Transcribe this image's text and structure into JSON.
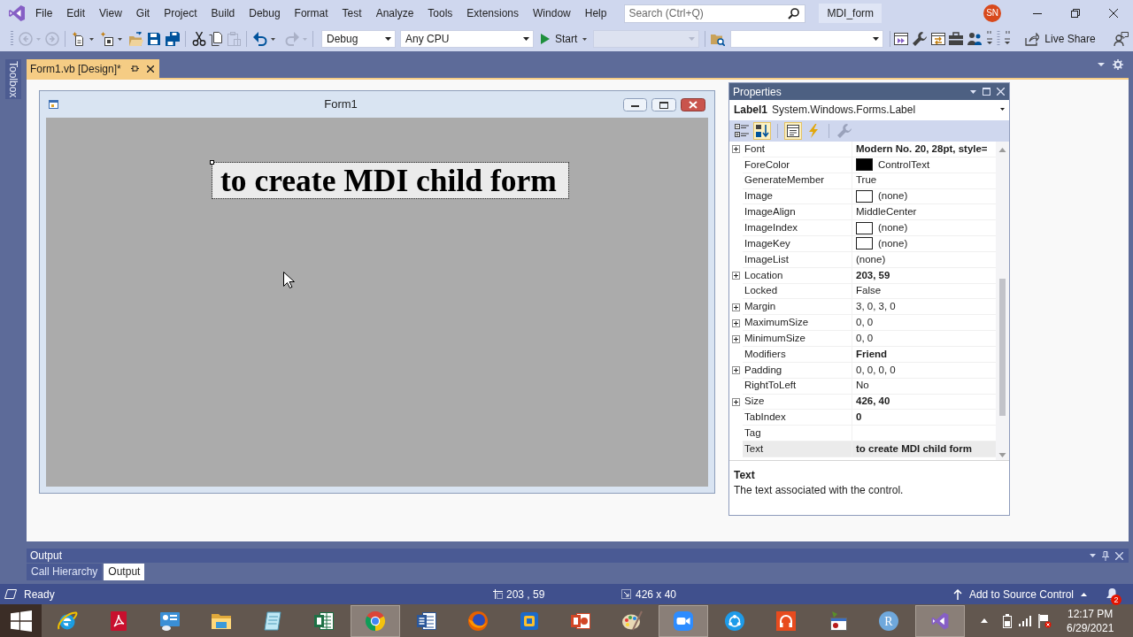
{
  "menu_bar": {
    "items": [
      "File",
      "Edit",
      "View",
      "Git",
      "Project",
      "Build",
      "Debug",
      "Format",
      "Test",
      "Analyze",
      "Tools",
      "Extensions",
      "Window",
      "Help"
    ],
    "search": {
      "placeholder": "Search (Ctrl+Q)"
    },
    "solution_name": "MDI_form",
    "user_initials": "SN"
  },
  "toolbar": {
    "button_groups": [
      [
        {
          "kind": "back",
          "disabled": true,
          "dropdown": true
        },
        {
          "kind": "forward",
          "disabled": true,
          "dropdown": false
        }
      ],
      [
        {
          "kind": "new_project",
          "disabled": false,
          "dropdown": true
        },
        {
          "kind": "add_item",
          "disabled": false,
          "dropdown": true
        },
        {
          "kind": "open",
          "disabled": false,
          "dropdown": false
        },
        {
          "kind": "save",
          "disabled": false,
          "dropdown": false
        },
        {
          "kind": "save_all",
          "disabled": false,
          "dropdown": false
        }
      ],
      [
        {
          "kind": "cut",
          "disabled": false,
          "dropdown": false
        },
        {
          "kind": "copy",
          "disabled": false,
          "dropdown": false
        },
        {
          "kind": "paste",
          "disabled": true,
          "dropdown": false
        }
      ],
      [
        {
          "kind": "undo",
          "disabled": false,
          "dropdown": true
        },
        {
          "kind": "redo",
          "disabled": true,
          "dropdown": true
        }
      ]
    ],
    "configuration": "Debug",
    "platform": "Any CPU",
    "start_label": "Start",
    "startup_item": {
      "disabled": true
    },
    "live_share_label": "Live Share"
  },
  "toolbox": {
    "label": "Toolbox"
  },
  "document_tabs": [
    {
      "label": "Form1.vb [Design]*",
      "selected": true
    }
  ],
  "designer": {
    "form": {
      "title": "Form1",
      "label": {
        "text": "to create MDI child form",
        "selected": true
      }
    }
  },
  "properties": {
    "title": "Properties",
    "object_name": "Label1",
    "object_type": "System.Windows.Forms.Label",
    "view_buttons": [
      {
        "kind": "categorized",
        "selected": false,
        "disabled": false
      },
      {
        "kind": "alphabetical",
        "selected": true,
        "disabled": false
      },
      {
        "kind": "properties",
        "selected": true,
        "disabled": false
      },
      {
        "kind": "events",
        "selected": false,
        "disabled": false
      },
      {
        "kind": "property_pages",
        "selected": false,
        "disabled": true
      }
    ],
    "rows": [
      {
        "name": "Font",
        "value": "Modern No. 20, 28pt, style=",
        "kind": "text",
        "expandable": true,
        "modified": true,
        "selected": false
      },
      {
        "name": "ForeColor",
        "value": "ControlText",
        "kind": "color",
        "color": "#000000",
        "expandable": false,
        "modified": false,
        "selected": false
      },
      {
        "name": "GenerateMember",
        "value": "True",
        "kind": "text",
        "expandable": false,
        "modified": false,
        "selected": false
      },
      {
        "name": "Image",
        "value": "(none)",
        "kind": "image",
        "expandable": false,
        "modified": false,
        "selected": false
      },
      {
        "name": "ImageAlign",
        "value": "MiddleCenter",
        "kind": "text",
        "expandable": false,
        "modified": false,
        "selected": false
      },
      {
        "name": "ImageIndex",
        "value": "(none)",
        "kind": "image",
        "expandable": false,
        "modified": false,
        "selected": false
      },
      {
        "name": "ImageKey",
        "value": "(none)",
        "kind": "image",
        "expandable": false,
        "modified": false,
        "selected": false
      },
      {
        "name": "ImageList",
        "value": "(none)",
        "kind": "text",
        "expandable": false,
        "modified": false,
        "selected": false
      },
      {
        "name": "Location",
        "value": "203, 59",
        "kind": "text",
        "expandable": true,
        "modified": true,
        "selected": false
      },
      {
        "name": "Locked",
        "value": "False",
        "kind": "text",
        "expandable": false,
        "modified": false,
        "selected": false
      },
      {
        "name": "Margin",
        "value": "3, 0, 3, 0",
        "kind": "text",
        "expandable": true,
        "modified": false,
        "selected": false
      },
      {
        "name": "MaximumSize",
        "value": "0, 0",
        "kind": "text",
        "expandable": true,
        "modified": false,
        "selected": false
      },
      {
        "name": "MinimumSize",
        "value": "0, 0",
        "kind": "text",
        "expandable": true,
        "modified": false,
        "selected": false
      },
      {
        "name": "Modifiers",
        "value": "Friend",
        "kind": "text",
        "expandable": false,
        "modified": true,
        "selected": false
      },
      {
        "name": "Padding",
        "value": "0, 0, 0, 0",
        "kind": "text",
        "expandable": true,
        "modified": false,
        "selected": false
      },
      {
        "name": "RightToLeft",
        "value": "No",
        "kind": "text",
        "expandable": false,
        "modified": false,
        "selected": false
      },
      {
        "name": "Size",
        "value": "426, 40",
        "kind": "text",
        "expandable": true,
        "modified": true,
        "selected": false
      },
      {
        "name": "TabIndex",
        "value": "0",
        "kind": "text",
        "expandable": false,
        "modified": true,
        "selected": false
      },
      {
        "name": "Tag",
        "kind": "text",
        "expandable": false,
        "selected": false
      },
      {
        "name": "Text",
        "value": "to create MDI child form",
        "kind": "text",
        "expandable": false,
        "modified": true,
        "selected": true
      }
    ],
    "description": {
      "title": "Text",
      "text": "The text associated with the control."
    }
  },
  "output": {
    "title": "Output",
    "tabs": [
      {
        "label": "Call Hierarchy",
        "selected": false
      },
      {
        "label": "Output",
        "selected": true
      }
    ]
  },
  "status_bar": {
    "text": "Ready",
    "position": "203 , 59",
    "size": "426 x 40",
    "source_control": "Add to Source Control",
    "notification_count": "2"
  },
  "taskbar": {
    "apps": [
      {
        "kind": "ie",
        "active": false
      },
      {
        "kind": "acrobat",
        "active": false
      },
      {
        "kind": "control_panel",
        "active": false
      },
      {
        "kind": "explorer",
        "active": false
      },
      {
        "kind": "notepad",
        "active": false
      },
      {
        "kind": "excel",
        "active": false
      },
      {
        "kind": "chrome",
        "active": true
      },
      {
        "kind": "word",
        "active": false
      },
      {
        "kind": "firefox",
        "active": false
      },
      {
        "kind": "virtualbox",
        "active": false
      },
      {
        "kind": "powerpoint",
        "active": false
      },
      {
        "kind": "paint",
        "active": false
      },
      {
        "kind": "zoom",
        "active": true
      },
      {
        "kind": "shareit",
        "active": false
      },
      {
        "kind": "audio",
        "active": false
      },
      {
        "kind": "app32",
        "active": false
      },
      {
        "kind": "r",
        "glyph": "R",
        "active": false
      },
      {
        "kind": "visual_studio",
        "active": true
      }
    ],
    "time": "12:17 PM",
    "date": "6/29/2021"
  }
}
